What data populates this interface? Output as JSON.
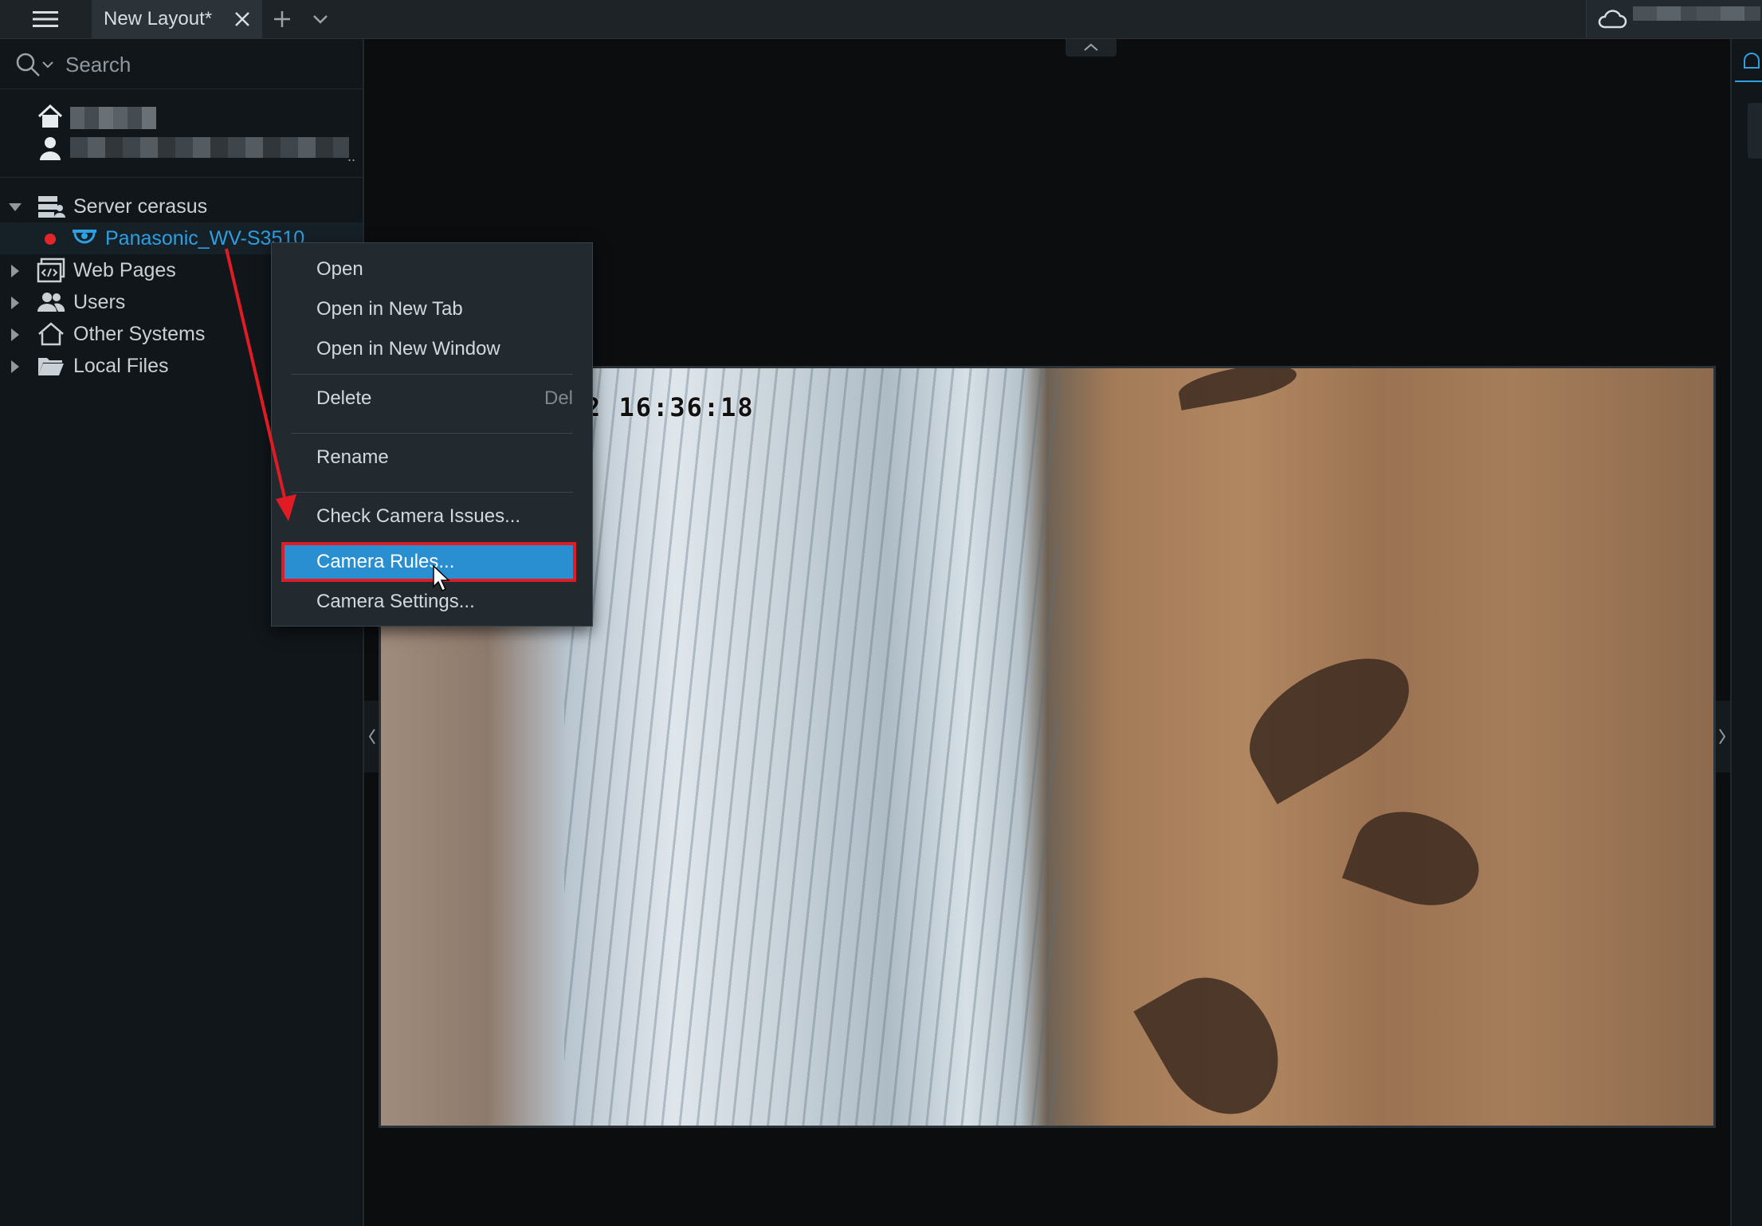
{
  "titlebar": {
    "tab_title": "New Layout*"
  },
  "search": {
    "placeholder": "Search"
  },
  "tree": {
    "server": "Server cerasus",
    "camera": "Panasonic_WV-S3510",
    "web_pages": "Web Pages",
    "users": "Users",
    "other_systems": "Other Systems",
    "local_files": "Local Files"
  },
  "context_menu": {
    "items": [
      {
        "label": "Open"
      },
      {
        "label": "Open in New Tab"
      },
      {
        "label": "Open in New Window"
      },
      {
        "label": "Delete",
        "shortcut": "Del"
      },
      {
        "label": "Rename"
      },
      {
        "label": "Check Camera Issues..."
      },
      {
        "label": "Camera Rules...",
        "selected": true
      },
      {
        "label": "Camera Settings..."
      }
    ]
  },
  "video": {
    "timestamp": "2 16:36:18"
  },
  "colors": {
    "accent": "#2e9fe0",
    "selection": "#2a8fd0",
    "annotation_red": "#e01b24",
    "recording_dot": "#e0262b"
  },
  "icons": [
    "menu-icon",
    "close-icon",
    "plus-icon",
    "chevron-down-icon",
    "cloud-icon",
    "search-icon",
    "home-icon",
    "person-icon",
    "server-icon",
    "camera-icon",
    "web-page-icon",
    "users-icon",
    "systems-icon",
    "folder-icon",
    "bell-icon",
    "chevron-up-icon",
    "chevron-left-icon",
    "chevron-right-icon",
    "cursor-icon"
  ]
}
